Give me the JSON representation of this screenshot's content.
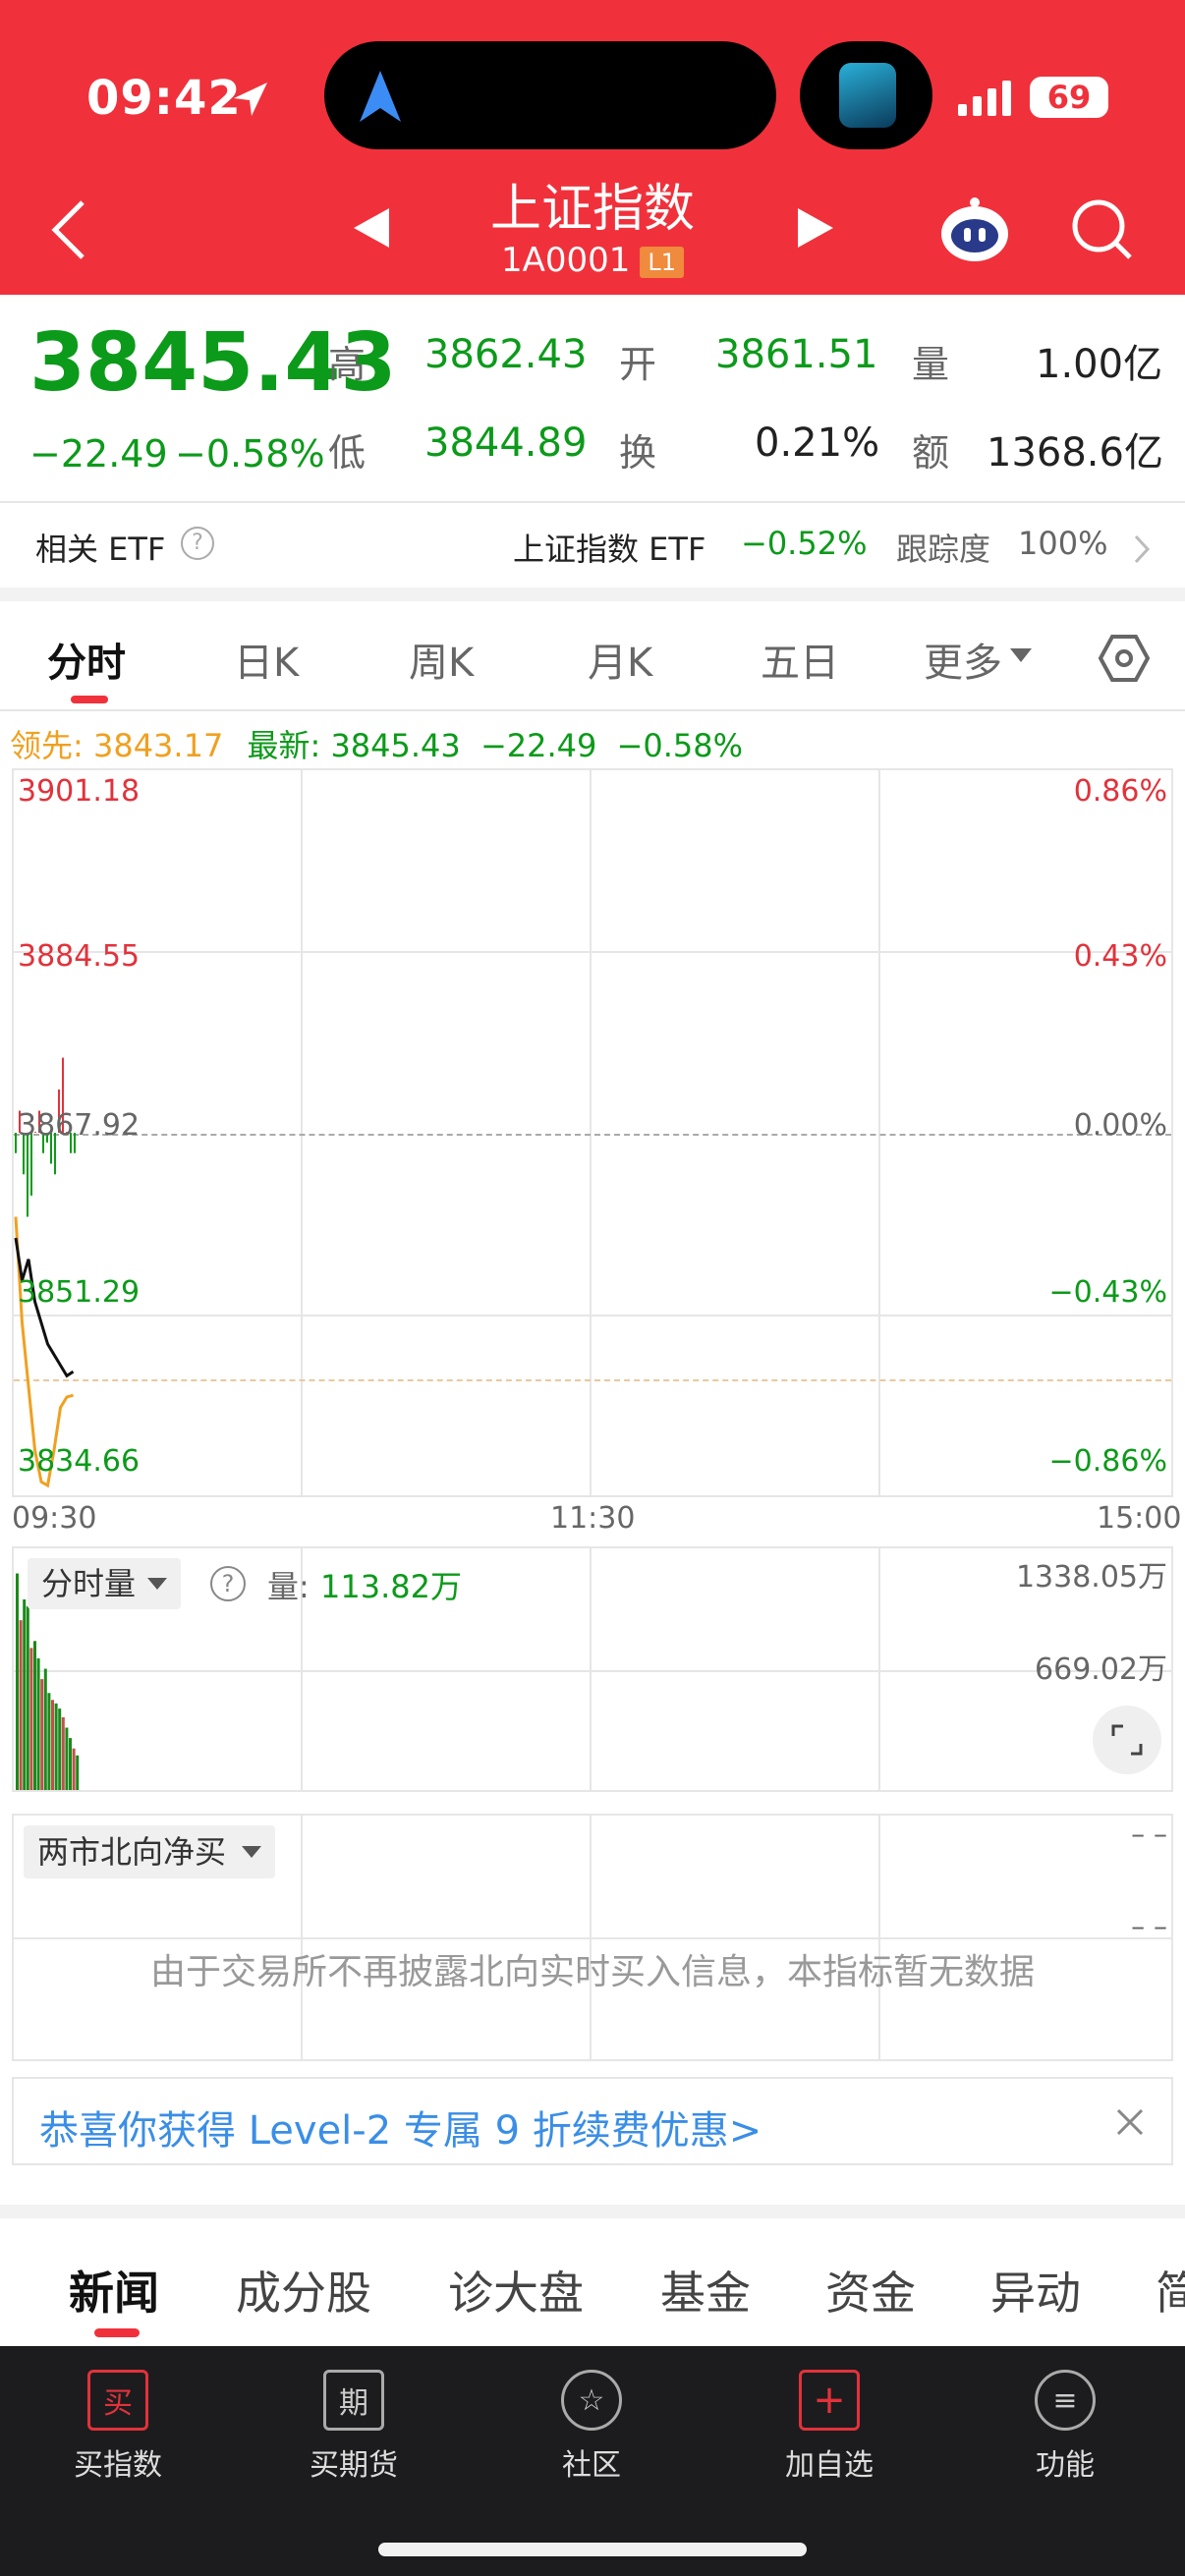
{
  "status": {
    "time": "09:42",
    "battery": "69"
  },
  "header": {
    "title": "上证指数",
    "code": "1A0001",
    "badge": "L1"
  },
  "quote": {
    "price": "3845.43",
    "change": "−22.49",
    "change_pct": "−0.58%",
    "high_label": "高",
    "high": "3862.43",
    "low_label": "低",
    "low": "3844.89",
    "open_label": "开",
    "open": "3861.51",
    "turnover_label": "换",
    "turnover": "0.21%",
    "volume_label": "量",
    "volume": "1.00亿",
    "amount_label": "额",
    "amount": "1368.6亿"
  },
  "etf": {
    "label": "相关 ETF",
    "name": "上证指数 ETF",
    "pct": "−0.52%",
    "track_label": "跟踪度",
    "track": "100%"
  },
  "tabs": [
    "分时",
    "日K",
    "周K",
    "月K",
    "五日",
    "更多"
  ],
  "chart_info": {
    "leader_label": "领先:",
    "leader_value": "3843.17",
    "latest_label": "最新:",
    "latest_value": "3845.43",
    "latest_change": "−22.49",
    "latest_pct": "−0.58%"
  },
  "chart_data": {
    "type": "line",
    "yticks_left": [
      "3901.18",
      "3884.55",
      "3867.92",
      "3851.29",
      "3834.66"
    ],
    "yticks_right": [
      "0.86%",
      "0.43%",
      "0.00%",
      "−0.43%",
      "−0.86%"
    ],
    "xticks": [
      "09:30",
      "11:30",
      "15:00"
    ],
    "ylim": [
      3834.66,
      3901.18
    ],
    "prev_close": 3867.92,
    "series": [
      {
        "values": [
          3858,
          3854,
          3856,
          3852,
          3850,
          3848,
          3847,
          3846,
          3845,
          3845.4
        ]
      },
      {
        "values": [
          3860,
          3850,
          3844,
          3838,
          3835,
          3834.66,
          3838,
          3842,
          3843,
          3843.17
        ]
      }
    ],
    "bar_values": [
      3866,
      3870,
      3864,
      3860,
      3862,
      3868,
      3870,
      3866,
      3867,
      3865,
      3864,
      3872,
      3875,
      3868,
      3866,
      3866
    ]
  },
  "volume": {
    "label": "分时量",
    "volume_label": "量:",
    "volume_value": "113.82万",
    "max": "1338.05万",
    "mid": "669.02万",
    "bars": [
      1250,
      980,
      1100,
      1060,
      820,
      860,
      760,
      640,
      700,
      560,
      520,
      500,
      470,
      420,
      360,
      300,
      240,
      200
    ]
  },
  "northbound": {
    "label": "两市北向净买",
    "dash1": "– –",
    "dash2": "– –",
    "message": "由于交易所不再披露北向实时买入信息，本指标暂无数据"
  },
  "promo": {
    "text": "恭喜你获得 Level-2 专属 9 折续费优惠>"
  },
  "news_tabs": [
    "新闻",
    "成分股",
    "诊大盘",
    "基金",
    "资金",
    "异动",
    "简"
  ],
  "bottom_nav": [
    {
      "label": "买指数",
      "icon": "买"
    },
    {
      "label": "买期货",
      "icon": "期"
    },
    {
      "label": "社区",
      "icon": "☆"
    },
    {
      "label": "加自选",
      "icon": "+"
    },
    {
      "label": "功能",
      "icon": "≡"
    }
  ],
  "colors": {
    "header_red": "#f0313b",
    "up_red": "#e2323b",
    "down_green": "#0c9a1a",
    "lead_orange": "#f0a020",
    "promo_blue": "#3a8ee6"
  }
}
